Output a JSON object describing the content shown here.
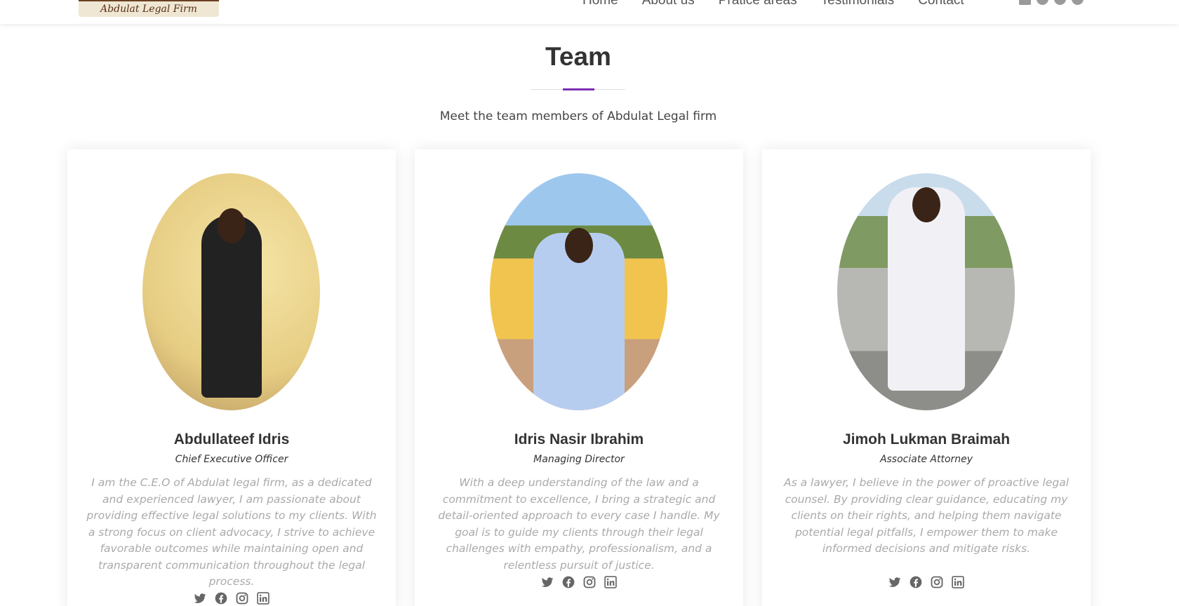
{
  "header": {
    "logo_text": "Abdulat Legal Firm",
    "nav": [
      "Home",
      "About us",
      "Pratice areas",
      "Testimonials",
      "Contact"
    ],
    "social_icons": [
      "linkedin-icon",
      "facebook-icon",
      "twitter-icon",
      "instagram-icon"
    ]
  },
  "section": {
    "title": "Team",
    "subtitle": "Meet the team members of Abdulat Legal firm",
    "accent_color": "#7b2fb5"
  },
  "team": [
    {
      "name": "Abdullateef Idris",
      "role": "Chief Executive Officer",
      "bio": "I am the C.E.O of Abdulat legal firm, as a dedicated and experienced lawyer, I am passionate about providing effective legal solutions to my clients. With a strong focus on client advocacy, I strive to achieve favorable outcomes while maintaining open and transparent communication throughout the legal process.",
      "social": [
        "twitter-icon",
        "facebook-icon",
        "instagram-icon",
        "linkedin-icon"
      ]
    },
    {
      "name": "Idris Nasir Ibrahim",
      "role": "Managing Director",
      "bio": "With a deep understanding of the law and a commitment to excellence, I bring a strategic and detail-oriented approach to every case I handle. My goal is to guide my clients through their legal challenges with empathy, professionalism, and a relentless pursuit of justice.",
      "social": [
        "twitter-icon",
        "facebook-icon",
        "instagram-icon",
        "linkedin-icon"
      ]
    },
    {
      "name": "Jimoh Lukman Braimah",
      "role": "Associate Attorney",
      "bio": "As a lawyer, I believe in the power of proactive legal counsel. By providing clear guidance, educating my clients on their rights, and helping them navigate potential legal pitfalls, I empower them to make informed decisions and mitigate risks.",
      "social": [
        "twitter-icon",
        "facebook-icon",
        "instagram-icon",
        "linkedin-icon"
      ]
    }
  ]
}
